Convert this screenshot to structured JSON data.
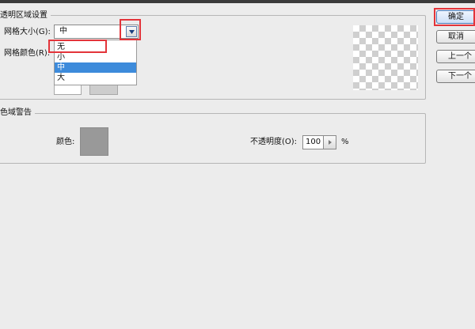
{
  "transparency_group": {
    "title": "透明区域设置",
    "grid_size_label": "网格大小(G):",
    "grid_size_value": "中",
    "grid_color_label": "网格颜色(R):",
    "grid_size_options": [
      "无",
      "小",
      "中",
      "大"
    ],
    "selected_option_index": 2
  },
  "gamut_group": {
    "title": "色域警告",
    "color_label": "颜色:",
    "color_value": "#999999",
    "opacity_label": "不透明度(O):",
    "opacity_value": "100",
    "opacity_unit": "%"
  },
  "buttons": {
    "ok": "确定",
    "cancel": "取消",
    "prev": "上一个",
    "next": "下一个"
  },
  "colors": {
    "highlight": "#e3343a",
    "selection": "#3d8bdb"
  },
  "icons": {
    "dropdown_arrow": "triangle-down",
    "stepper_arrow": "triangle-right"
  }
}
